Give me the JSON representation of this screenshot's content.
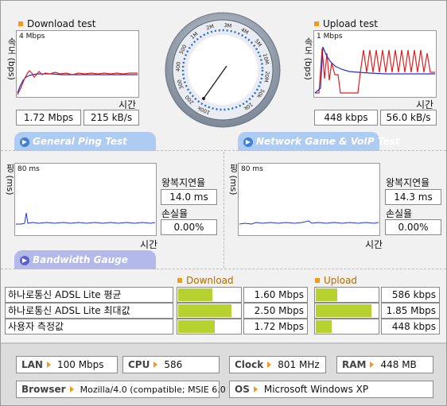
{
  "download": {
    "title": "Download test",
    "axis_y": "속도 (bps)",
    "axis_x": "시간",
    "scale": "4 Mbps",
    "value_mbps": "1.72 Mbps",
    "value_kbs": "215 kB/s"
  },
  "upload": {
    "title": "Upload test",
    "axis_y": "속도 (bps)",
    "axis_x": "시간",
    "scale": "1 Mbps",
    "value_kbps": "448 kbps",
    "value_kbs": "56.0 kB/s"
  },
  "gauge": {
    "labels": [
      "100k",
      "200",
      "300",
      "400",
      "500",
      "1M",
      "2M",
      "3M",
      "4M",
      "5M",
      "10M",
      "20M",
      "50k",
      "10k"
    ]
  },
  "tabs": {
    "ping": "General Ping Test",
    "game": "Network Game & VoIP Test",
    "bandwidth": "Bandwidth Gauge"
  },
  "ping_left": {
    "axis_y": "핑 (ms)",
    "axis_x": "시간",
    "scale": "80 ms",
    "rtt_label": "왕복지연율",
    "rtt_value": "14.0 ms",
    "loss_label": "손실율",
    "loss_value": "0.00%"
  },
  "ping_right": {
    "axis_y": "핑 (ms)",
    "axis_x": "시간",
    "scale": "80 ms",
    "rtt_label": "왕복지연율",
    "rtt_value": "14.3 ms",
    "loss_label": "손실율",
    "loss_value": "0.00%"
  },
  "bandwidth": {
    "download_header": "Download",
    "upload_header": "Upload",
    "rows": [
      {
        "label": "하나로통신 ADSL Lite 평균",
        "download": "1.60 Mbps",
        "upload": "586 kbps",
        "download_fill": 0.55,
        "upload_fill": 0.35
      },
      {
        "label": "하나로통신 ADSL Lite 최대값",
        "download": "2.50 Mbps",
        "upload": "1.85 Mbps",
        "download_fill": 0.86,
        "upload_fill": 0.9
      },
      {
        "label": "사용자 측정값",
        "download": "1.72 Mbps",
        "upload": "448 kbps",
        "download_fill": 0.59,
        "upload_fill": 0.26
      }
    ]
  },
  "system": {
    "lan_label": "LAN",
    "lan_value": "100 Mbps",
    "cpu_label": "CPU",
    "cpu_value": "586",
    "clock_label": "Clock",
    "clock_value": "801 MHz",
    "ram_label": "RAM",
    "ram_value": "448 MB",
    "browser_label": "Browser",
    "browser_value": "Mozilla/4.0 (compatible; MSIE 6.0",
    "os_label": "OS",
    "os_value": "Microsoft Windows XP"
  },
  "colors": {
    "accent_orange": "#f39a1a",
    "tab_blue": "#aecbf2",
    "tab_violet": "#b3b9ea",
    "bar_green": "#b5d22e",
    "line_red": "#e02020",
    "line_blue": "#2233cc"
  }
}
